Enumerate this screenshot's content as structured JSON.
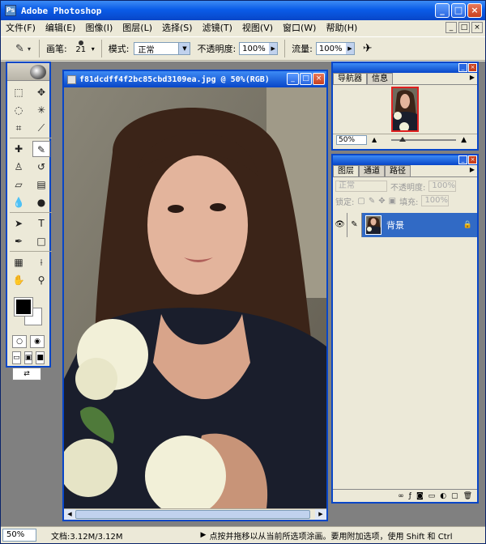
{
  "app": {
    "title": "Adobe Photoshop",
    "icon_label": "Ps"
  },
  "window_controls": {
    "minimize": "_",
    "maximize": "□",
    "close": "×"
  },
  "menu": [
    {
      "label": "文件(F)"
    },
    {
      "label": "编辑(E)"
    },
    {
      "label": "图像(I)"
    },
    {
      "label": "图层(L)"
    },
    {
      "label": "选择(S)"
    },
    {
      "label": "滤镜(T)"
    },
    {
      "label": "视图(V)"
    },
    {
      "label": "窗口(W)"
    },
    {
      "label": "帮助(H)"
    }
  ],
  "options": {
    "brush_label": "画笔:",
    "brush_size": "21",
    "mode_label": "模式:",
    "mode_value": "正常",
    "opacity_label": "不透明度:",
    "opacity_value": "100%",
    "flow_label": "流量:",
    "flow_value": "100%"
  },
  "document": {
    "title": "f81dcdff4f2bc85cbd3109ea.jpg @ 50%(RGB)"
  },
  "navigator": {
    "tabs": [
      "导航器",
      "信息"
    ],
    "zoom": "50%"
  },
  "layers": {
    "tabs": [
      "图层",
      "通道",
      "路径"
    ],
    "blend_mode": "正常",
    "opacity_label": "不透明度:",
    "opacity_value": "100%",
    "lock_label": "锁定:",
    "fill_label": "填充:",
    "fill_value": "100%",
    "rows": [
      {
        "name": "背景"
      }
    ]
  },
  "status": {
    "zoom": "50%",
    "doc_info": "文档:3.12M/3.12M",
    "hint": "点按并拖移以从当前所选项涂画。要用附加选项，使用 Shift 和 Ctrl"
  },
  "colors": {
    "title_bar": "#0a5ce8",
    "chrome": "#ece9d8",
    "selection": "#316ac5",
    "workspace": "#808080"
  }
}
